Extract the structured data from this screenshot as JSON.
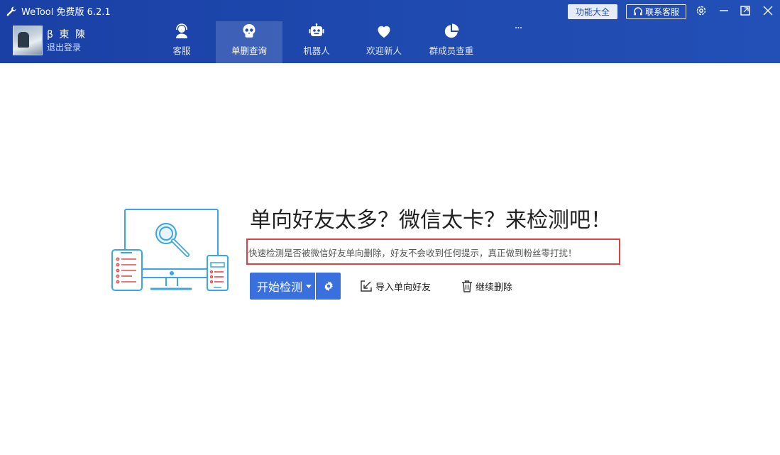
{
  "app": {
    "title": "WeTool 免费版 6.2.1"
  },
  "title_bar": {
    "features_label": "功能大全",
    "contact_label": "联系客服",
    "icons": [
      "wrench-icon",
      "headset-icon",
      "settings-icon",
      "minimize-icon",
      "maximize-icon",
      "close-icon"
    ]
  },
  "user": {
    "name": "β 東 陳",
    "logout_label": "退出登录"
  },
  "nav": {
    "items": [
      {
        "label": "客服",
        "icon": "customer-service-icon"
      },
      {
        "label": "单删查询",
        "icon": "skull-icon",
        "active": true
      },
      {
        "label": "机器人",
        "icon": "robot-icon"
      },
      {
        "label": "欢迎新人",
        "icon": "heart-icon"
      },
      {
        "label": "群成员查重",
        "icon": "pie-chart-icon"
      }
    ],
    "more_label": "···"
  },
  "main": {
    "headline": "单向好友太多？微信太卡？来检测吧！",
    "description": "快速检测是否被微信好友单向删除，好友不会收到任何提示，真正做到粉丝零打扰！",
    "start_button_label": "开始检测",
    "import_label": "导入单向好友",
    "continue_delete_label": "继续删除"
  },
  "colors": {
    "header": "#1f4ab0",
    "primary_button": "#3a6fde",
    "highlight_border": "#e43d3d",
    "illustration": "#3aa6e8"
  }
}
